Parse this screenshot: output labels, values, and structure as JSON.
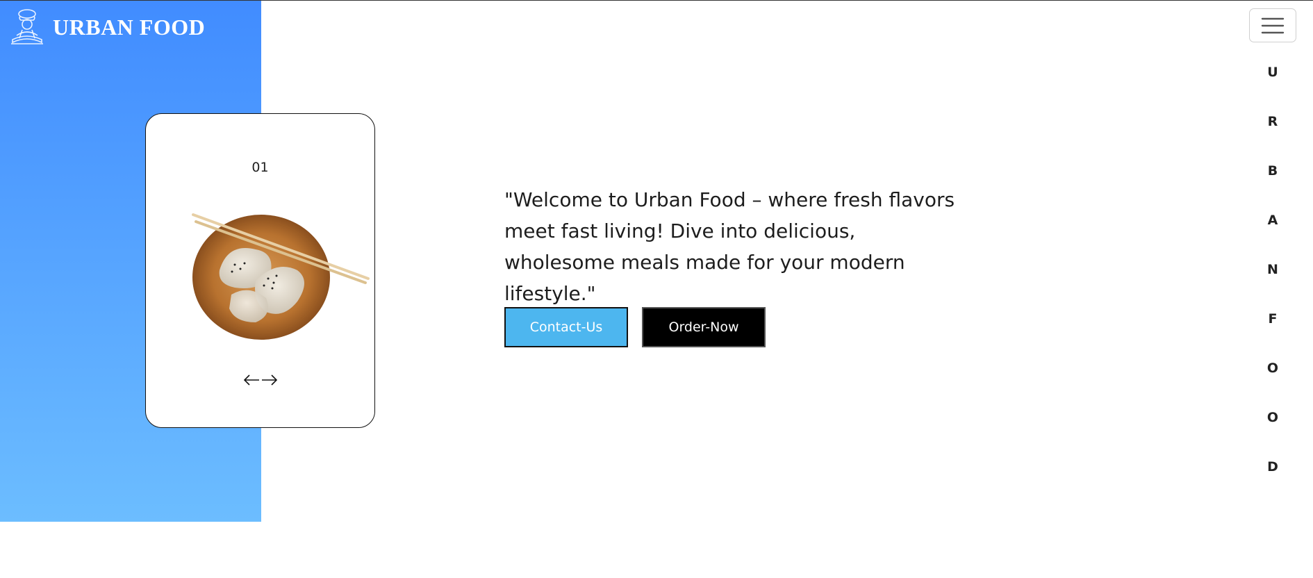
{
  "brand": {
    "name": "URBAN FOOD",
    "logo_icon": "chef-icon",
    "logo_color": "#ffffff"
  },
  "side_panel": {
    "gradient_top": "#418cff",
    "gradient_bottom": "#6cbdff"
  },
  "carousel": {
    "slide_number": "01",
    "image": "dumplings-bowl-chopsticks",
    "prev_icon": "arrow-left-icon",
    "next_icon": "arrow-right-icon"
  },
  "hero": {
    "text": "\"Welcome to Urban Food – where fresh flavors meet fast living! Dive into delicious, wholesome meals made for your modern lifestyle.\""
  },
  "buttons": {
    "contact_label": "Contact-Us",
    "contact_color": "#4db6ef",
    "order_label": "Order-Now",
    "order_color": "#000000"
  },
  "nav": {
    "menu_icon": "hamburger-icon",
    "letters": [
      "U",
      "R",
      "B",
      "A",
      "N",
      "F",
      "O",
      "O",
      "D"
    ]
  }
}
